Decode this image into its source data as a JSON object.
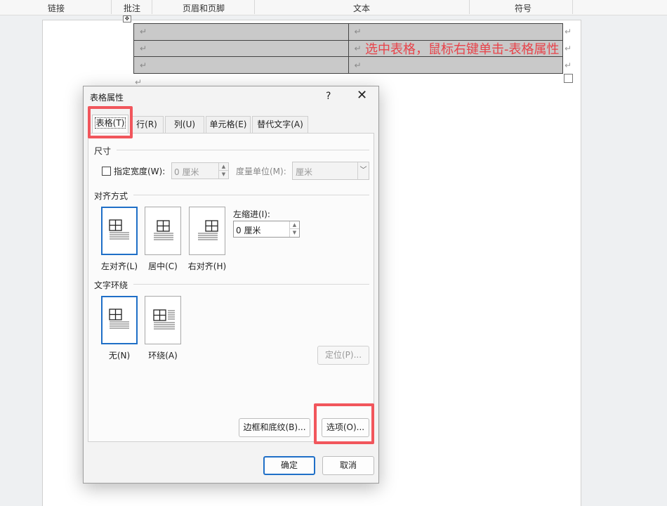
{
  "ribbon": {
    "groups": [
      "链接",
      "批注",
      "页眉和页脚",
      "文本",
      "符号"
    ]
  },
  "document": {
    "instruction": "选中表格，鼠标右键单击-表格属性",
    "para_mark": "↵",
    "table_rows": 3,
    "table_cols": 2
  },
  "dialog": {
    "title": "表格属性",
    "help": "?",
    "close": "✕",
    "tabs": [
      "表格(T)",
      "行(R)",
      "列(U)",
      "单元格(E)",
      "替代文字(A)"
    ],
    "size": {
      "section": "尺寸",
      "specify_width_label": "指定宽度(W):",
      "width_value": "0 厘米",
      "unit_label": "度量单位(M):",
      "unit_value": "厘米"
    },
    "alignment": {
      "section": "对齐方式",
      "options": [
        "左对齐(L)",
        "居中(C)",
        "右对齐(H)"
      ],
      "indent_label": "左缩进(I):",
      "indent_value": "0 厘米"
    },
    "wrapping": {
      "section": "文字环绕",
      "options": [
        "无(N)",
        "环绕(A)"
      ]
    },
    "buttons": {
      "position": "定位(P)...",
      "borders": "边框和底纹(B)...",
      "options": "选项(O)...",
      "ok": "确定",
      "cancel": "取消"
    }
  },
  "colors": {
    "highlight": "#f1565c",
    "selected_accent": "#1f6fc7",
    "instruction_text": "#e8434a",
    "table_shading": "#c9c9c9"
  }
}
